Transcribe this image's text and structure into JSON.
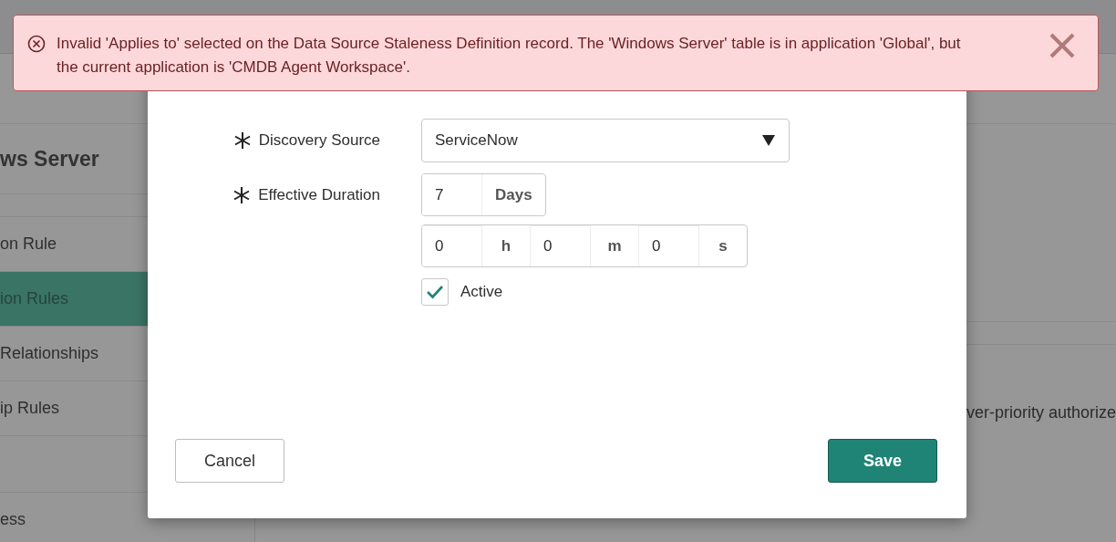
{
  "background": {
    "sidebar": {
      "title": "ws Server",
      "items": [
        {
          "label": "on Rule",
          "selected": false
        },
        {
          "label": "ion Rules",
          "selected": true
        },
        {
          "label": "Relationships",
          "selected": false
        },
        {
          "label": "ip Rules",
          "selected": false
        }
      ],
      "footer_item": "ess"
    },
    "main_text": "ver-priority authorize"
  },
  "alert": {
    "kind": "error",
    "message": "Invalid 'Applies to' selected on the Data Source Staleness Definition record. The 'Windows Server' table is in application 'Global', but the current application is 'CMDB Agent Workspace'."
  },
  "dialog": {
    "discovery_source": {
      "label": "Discovery Source",
      "required": true,
      "value": "ServiceNow"
    },
    "effective_duration": {
      "label": "Effective Duration",
      "required": true,
      "days": {
        "value": "7",
        "unit": "Days"
      },
      "time": [
        {
          "value": "0",
          "unit": "h"
        },
        {
          "value": "0",
          "unit": "m"
        },
        {
          "value": "0",
          "unit": "s"
        }
      ]
    },
    "active": {
      "label": "Active",
      "checked": true
    },
    "buttons": [
      {
        "label": "Cancel",
        "kind": "secondary"
      },
      {
        "label": "Save",
        "kind": "primary"
      }
    ]
  }
}
